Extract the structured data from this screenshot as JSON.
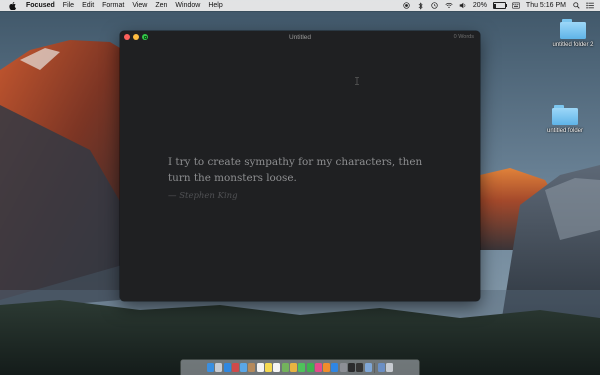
{
  "menubar": {
    "app_name": "Focused",
    "items": [
      "File",
      "Edit",
      "Format",
      "View",
      "Zen",
      "Window",
      "Help"
    ],
    "battery_percent": "20%",
    "battery_level": 0.2,
    "clock": "Thu 5:16 PM"
  },
  "desktop": {
    "folders": [
      {
        "label": "untitled folder 2"
      },
      {
        "label": "untitled folder"
      }
    ]
  },
  "window": {
    "title": "Untitled",
    "word_count": "0 Words",
    "quote": "I try to create sympathy for my characters, then turn the monsters loose.",
    "attribution": "— Stephen King"
  },
  "dock": {
    "icons": [
      {
        "name": "finder-icon",
        "color": "#3b8fe0"
      },
      {
        "name": "launchpad-icon",
        "color": "#c9ccd2"
      },
      {
        "name": "safari-icon",
        "color": "#2f87e0"
      },
      {
        "name": "photos-app-icon",
        "color": "#d04a4a"
      },
      {
        "name": "mail-icon",
        "color": "#5aa7e8"
      },
      {
        "name": "contacts-icon",
        "color": "#b58a5c"
      },
      {
        "name": "calendar-icon",
        "color": "#f3f3f3"
      },
      {
        "name": "notes-icon",
        "color": "#f5d94f"
      },
      {
        "name": "reminders-icon",
        "color": "#f4f4f4"
      },
      {
        "name": "maps-icon",
        "color": "#73b25c"
      },
      {
        "name": "photos-icon",
        "color": "#e7b341"
      },
      {
        "name": "messages-icon",
        "color": "#4ec35b"
      },
      {
        "name": "facetime-icon",
        "color": "#3fb34f"
      },
      {
        "name": "itunes-icon",
        "color": "#e44b8a"
      },
      {
        "name": "ibooks-icon",
        "color": "#f08c2a"
      },
      {
        "name": "app-store-icon",
        "color": "#2f86e3"
      },
      {
        "name": "system-preferences-icon",
        "color": "#8c8f96"
      },
      {
        "name": "focused-app-icon",
        "color": "#2a2b2d"
      },
      {
        "name": "terminal-icon",
        "color": "#333333"
      },
      {
        "name": "preview-icon",
        "color": "#7fa7d8"
      },
      {
        "name": "downloads-icon",
        "color": "#6b8fc4"
      },
      {
        "name": "trash-icon",
        "color": "#c7cbd1"
      }
    ]
  }
}
